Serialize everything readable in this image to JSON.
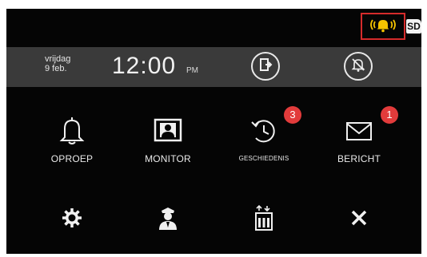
{
  "status": {
    "bell_icon": "ringing-bell-icon",
    "sd_label": "SD"
  },
  "infobar": {
    "day": "vrijdag",
    "date": "9 feb.",
    "time": "12:00",
    "ampm": "PM",
    "door_icon": "door-exit-icon",
    "mute_icon": "mute-bell-icon"
  },
  "menu": {
    "items": [
      {
        "label": "OPROEP",
        "icon": "bell-icon"
      },
      {
        "label": "MONITOR",
        "icon": "monitor-icon"
      },
      {
        "label": "GESCHIEDENIS",
        "icon": "history-icon",
        "badge": "3"
      },
      {
        "label": "BERICHT",
        "icon": "envelope-icon",
        "badge": "1"
      }
    ],
    "bottom_icons": [
      "gear-icon",
      "guard-icon",
      "elevator-icon",
      "close-icon"
    ]
  },
  "colors": {
    "accent_yellow": "#f5c400",
    "highlight_red": "#d62b2b",
    "badge_red": "#e23b3b",
    "bar_grey": "#3a3a3a"
  }
}
